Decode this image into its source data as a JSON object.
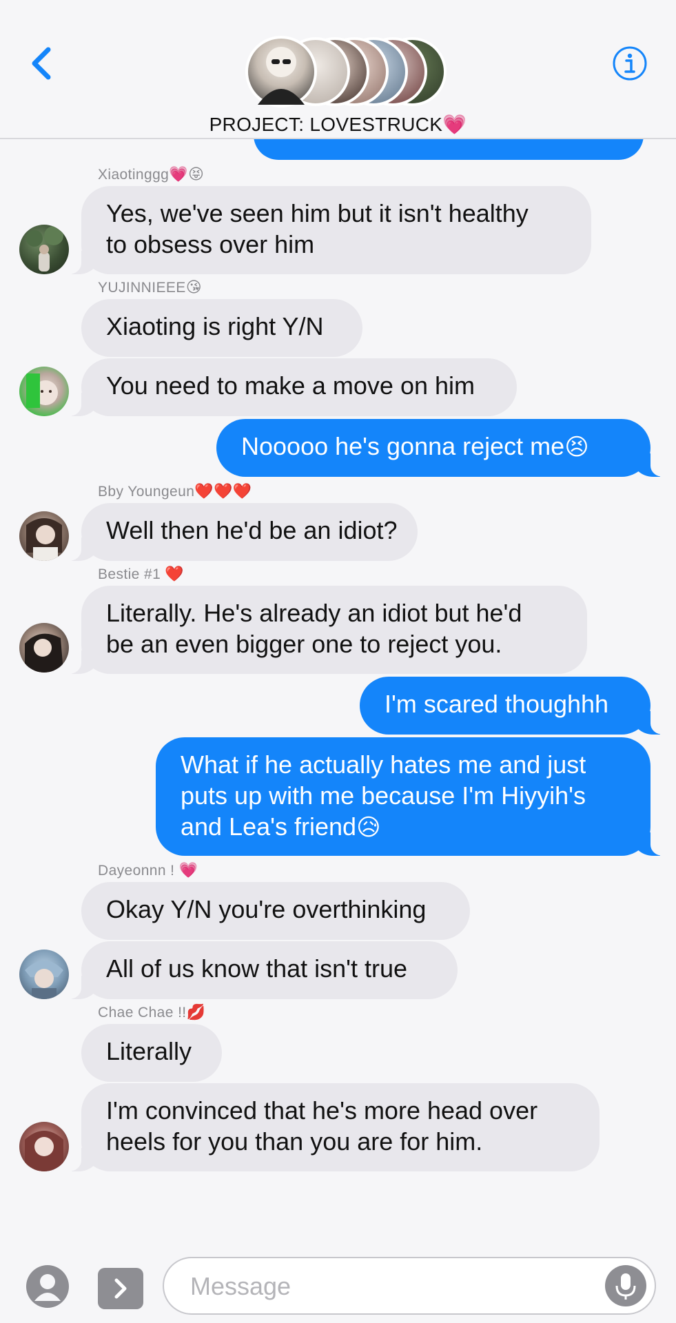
{
  "header": {
    "title": "PROJECT: LOVESTRUCK",
    "title_emoji": "💗",
    "back_icon": "chevron-left-icon",
    "info_icon": "info-icon"
  },
  "colors": {
    "accent": "#1485fa",
    "incoming_bubble": "#e8e7ec",
    "background": "#f6f6f8",
    "sender_text": "#8a8a8e"
  },
  "messages": [
    {
      "sender": "Xiaotinggg",
      "sender_emoji": "💗😝",
      "text": "Yes, we've seen him but it isn't healthy",
      "text2": "to obsess over him"
    },
    {
      "sender": "YUJINNIEEE",
      "sender_emoji": "😘",
      "text": "Xiaoting is right Y/N"
    },
    {
      "text": "You need to make a move on him"
    },
    {
      "text": "Nooooo he's gonna reject me",
      "emoji": "😣"
    },
    {
      "sender": "Bby Youngeun",
      "sender_emoji": "❤️❤️❤️",
      "text": "Well then he'd be an idiot?"
    },
    {
      "sender": "Bestie #1",
      "sender_emoji": "❤️",
      "text": "Literally. He's already an idiot but he'd",
      "text2": "be an even bigger one to reject you."
    },
    {
      "text": "I'm scared thoughhh"
    },
    {
      "text": "What if he actually hates me and just",
      "text2": "puts up with me because I'm Hiyyih's",
      "text3": "and Lea's friend",
      "emoji": "😥"
    },
    {
      "sender": "Dayeonnn !",
      "sender_emoji": "💗",
      "text": "Okay Y/N you're overthinking"
    },
    {
      "text": "All of us know that isn't true"
    },
    {
      "sender": "Chae Chae !!",
      "sender_emoji": "💋",
      "text": "Literally"
    },
    {
      "text": "I'm convinced that he's more head over",
      "text2": "heels for you than you are for him."
    }
  ],
  "composer": {
    "placeholder": "Message",
    "apps_icon": "app-store-icon",
    "expand_icon": "chevron-right-icon",
    "mic_icon": "microphone-icon"
  }
}
